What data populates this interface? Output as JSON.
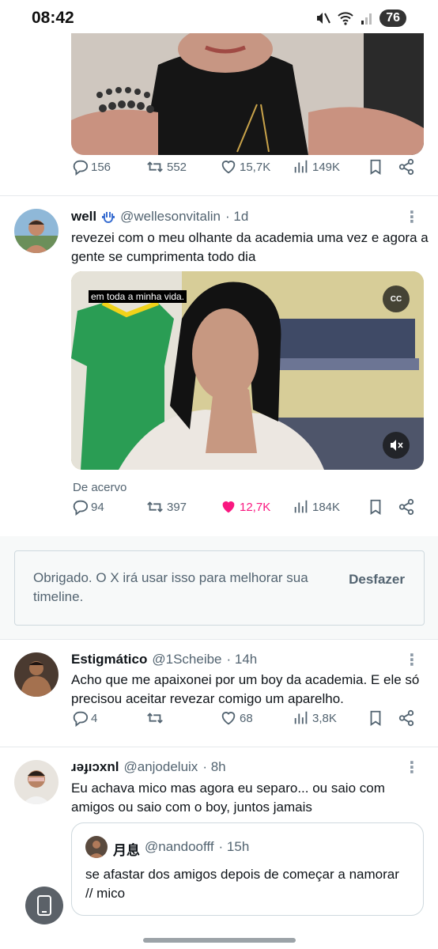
{
  "status_bar": {
    "time": "08:42",
    "battery": "76"
  },
  "tweet1_actions": {
    "replies": "156",
    "reposts": "552",
    "likes": "15,7K",
    "views": "149K"
  },
  "tweet2": {
    "name": "well",
    "handle": "@wellesonvitalin",
    "time": "· 1d",
    "text": "revezei com o meu olhante da academia uma vez e agora a gente se cumprimenta todo dia",
    "caption": "em toda a minha vida.",
    "cc": "CC",
    "source": "De acervo",
    "replies": "94",
    "reposts": "397",
    "likes": "12,7K",
    "views": "184K"
  },
  "feedback": {
    "text": "Obrigado. O X irá usar isso para melhorar sua timeline.",
    "undo": "Desfazer"
  },
  "tweet3": {
    "name": "Estigmático",
    "handle": "@1Scheibe",
    "time": "· 14h",
    "text": "Acho que me apaixonei por um boy da academia. E ele só precisou aceitar revezar comigo um aparelho.",
    "replies": "4",
    "reposts": "",
    "likes": "68",
    "views": "3,8K"
  },
  "tweet4": {
    "name": "ɹǝɟıɔxnl",
    "handle": "@anjodeluix",
    "time": "· 8h",
    "text": "Eu achava mico mas agora eu separo... ou saio com amigos ou saio com o boy, juntos jamais",
    "quote": {
      "name": "月息",
      "handle": "@nandoofff",
      "time": "· 15h",
      "text": "se afastar dos amigos depois de começar a namorar // mico"
    }
  },
  "colors": {
    "like_active": "#f91880",
    "muted_text": "#536471",
    "divider": "#e6e9ec"
  }
}
